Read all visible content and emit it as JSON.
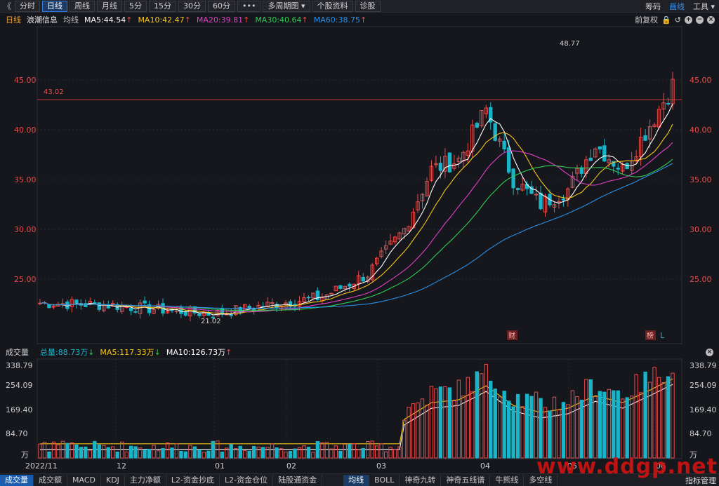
{
  "toolbar": {
    "back": "《",
    "periods": [
      "分时",
      "日线",
      "周线",
      "月线",
      "5分",
      "15分",
      "30分",
      "60分",
      "•••",
      "多周期图 ▾",
      "个股资料",
      "诊股"
    ],
    "active_index": 1,
    "right": [
      "筹码",
      "画线",
      "工具 ▾"
    ]
  },
  "ma_legend": {
    "period": "日线",
    "stock": "浪潮信息",
    "type": "均线",
    "items": [
      {
        "label": "MA5:44.54",
        "color": "#ffffff"
      },
      {
        "label": "MA10:42.47",
        "color": "#f5c518"
      },
      {
        "label": "MA20:39.81",
        "color": "#e040c8"
      },
      {
        "label": "MA30:40.64",
        "color": "#2ecc55"
      },
      {
        "label": "MA60:38.75",
        "color": "#2a8fe6"
      }
    ],
    "right_text": "前复权"
  },
  "price_axis": {
    "ticks": [
      "45.00",
      "40.00",
      "35.00",
      "30.00",
      "25.00"
    ]
  },
  "annotations": {
    "high": "48.77",
    "low": "21.02",
    "line_value": "43.02",
    "badge_cai": "财",
    "badge_bang": "榜",
    "badge_l": "L"
  },
  "volume": {
    "title": "成交量",
    "total": "总量:88.73万",
    "ma5": "MA5:117.33万",
    "ma10": "MA10:126.73万",
    "ticks": [
      "338.79",
      "254.09",
      "169.40",
      "84.70",
      "万"
    ]
  },
  "x_axis": {
    "labels": [
      "2022/11",
      "12",
      "01",
      "02",
      "03",
      "04",
      "05",
      "06"
    ]
  },
  "tabs": [
    "成交量",
    "成交额",
    "MACD",
    "KDJ",
    "主力净额",
    "L2-资金抄底",
    "L2-资金仓位",
    "陆股通资金",
    "均线",
    "BOLL",
    "神奇九转",
    "神奇五线谱",
    "牛熊线",
    "多空线"
  ],
  "tabs_right": "指标管理",
  "watermark": "www.ddgp.net",
  "colors": {
    "up": "#e84c4c",
    "down": "#1ab4c8",
    "ma5": "#ffffff",
    "ma10": "#f5c518",
    "ma20": "#e040c8",
    "ma30": "#2ecc55",
    "ma60": "#2a8fe6"
  }
}
